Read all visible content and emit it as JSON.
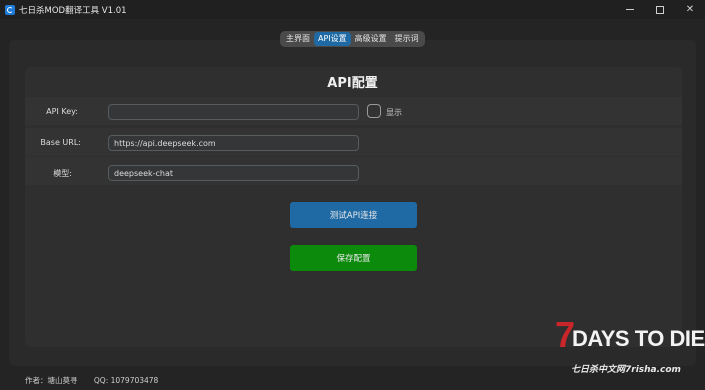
{
  "window": {
    "title": "七日杀MOD翻译工具 V1.01",
    "controls": [
      "minimize",
      "maximize",
      "close"
    ]
  },
  "tabs": [
    {
      "label": "主界面",
      "active": false
    },
    {
      "label": "API设置",
      "active": true
    },
    {
      "label": "高级设置",
      "active": false
    },
    {
      "label": "提示词",
      "active": false
    }
  ],
  "panel": {
    "title": "API配置",
    "api_key": {
      "label": "API Key:",
      "value": ""
    },
    "show_checkbox": {
      "label": "显示",
      "checked": false
    },
    "base_url": {
      "label": "Base URL:",
      "value": "https://api.deepseek.com"
    },
    "model": {
      "label": "模型:",
      "value": "deepseek-chat"
    },
    "test_button": "测试API连接",
    "save_button": "保存配置"
  },
  "footer": {
    "author": "作者：塘山莫寻",
    "qq": "QQ: 1079703478"
  },
  "logo": {
    "seven": "7",
    "days": "DAYS TO DIE",
    "sub": "七日杀中文网7risha.com"
  },
  "colors": {
    "accent": "#1f6aa5",
    "save": "#0c8a0c",
    "logo_red": "#c8262b"
  }
}
